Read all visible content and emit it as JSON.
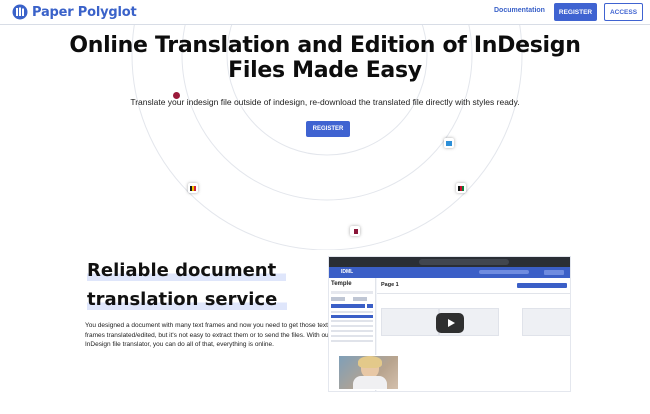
{
  "header": {
    "brand": "Paper Polyglot",
    "logo_icon": "books-icon",
    "nav_documentation": "Documentation",
    "register_label": "REGISTER",
    "access_label": "ACCESS",
    "accent_color": "#3f63d1"
  },
  "hero": {
    "title_line1": "Online Translation and Edition of InDesign",
    "title_line2": "Files Made Easy",
    "subtitle": "Translate your indesign file outside of indesign, re-download the translated file directly with styles ready.",
    "register_label": "REGISTER",
    "flags": [
      "flag-red-icon",
      "flag-blue-icon",
      "flag-belgium-icon",
      "flag-afghanistan-icon",
      "flag-qatar-icon"
    ]
  },
  "section": {
    "title_line1": "Reliable document",
    "title_line2": "translation service",
    "body": "You designed a document with many text frames and now you need to get those text frames translated/edited, but it's not easy to extract them or to send the files. With our InDesign file translator, you can do all of that, everything is online."
  },
  "video": {
    "app_name": "IDML",
    "sidebar_title": "Temple",
    "page_label": "Page 1"
  }
}
